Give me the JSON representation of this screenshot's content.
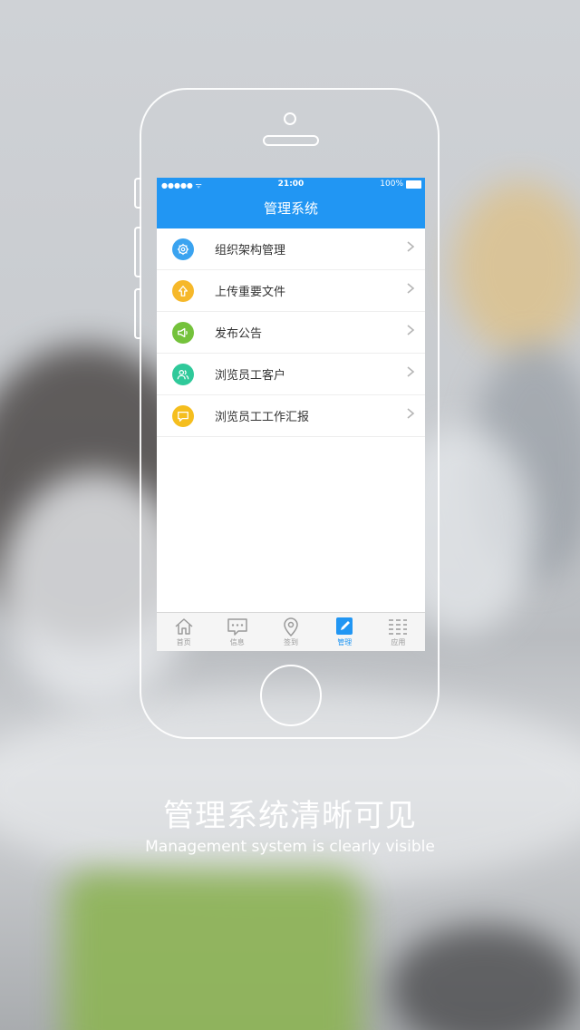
{
  "status": {
    "signal": "●●●●● ᯤ",
    "time": "21:00",
    "battery": "100%"
  },
  "header": {
    "title": "管理系统"
  },
  "menu": [
    {
      "label": "组织架构管理",
      "color": "#3aa3f0",
      "icon": "gear-icon"
    },
    {
      "label": "上传重要文件",
      "color": "#f6b82a",
      "icon": "upload-arrow-icon"
    },
    {
      "label": "发布公告",
      "color": "#74c23b",
      "icon": "megaphone-icon"
    },
    {
      "label": "浏览员工客户",
      "color": "#2fc99a",
      "icon": "users-icon"
    },
    {
      "label": "浏览员工工作汇报",
      "color": "#f5be1e",
      "icon": "chat-bubble-icon"
    }
  ],
  "tabs": [
    {
      "label": "首页",
      "icon": "home-icon"
    },
    {
      "label": "信息",
      "icon": "message-icon"
    },
    {
      "label": "签到",
      "icon": "location-pin-icon"
    },
    {
      "label": "管理",
      "icon": "edit-icon",
      "active": true
    },
    {
      "label": "应用",
      "icon": "apps-icon"
    }
  ],
  "caption": {
    "title": "管理系统清晰可见",
    "subtitle": "Management system is clearly visible"
  },
  "colors": {
    "primary": "#2196f3",
    "inactive": "#9a9a9a"
  }
}
